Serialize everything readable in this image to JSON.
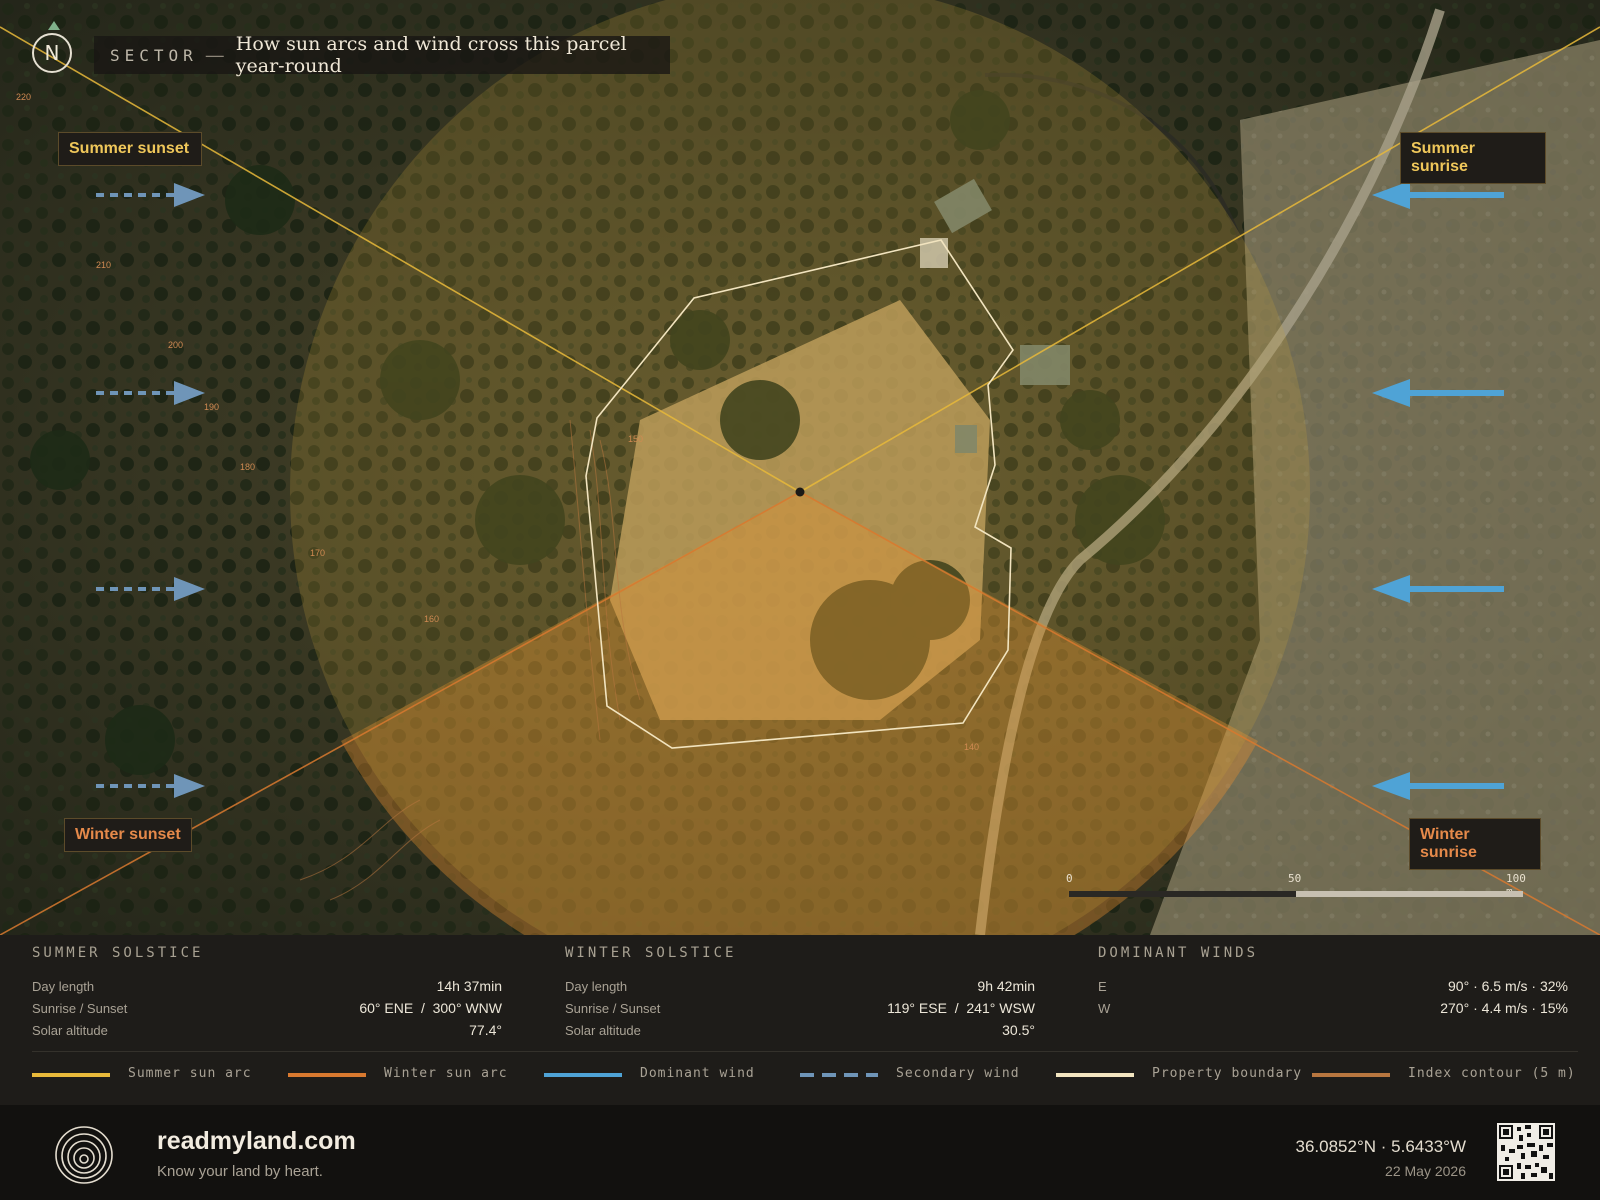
{
  "header": {
    "tag": "SECTOR",
    "dash": "—",
    "title": "How sun arcs and wind cross this parcel year-round",
    "north": "N"
  },
  "sun_labels": {
    "summer_sunset": "Summer sunset",
    "summer_sunrise": "Summer sunrise",
    "winter_sunset": "Winter sunset",
    "winter_sunrise": "Winter sunrise"
  },
  "contours": [
    "220",
    "210",
    "200",
    "190",
    "180",
    "170",
    "160",
    "150",
    "140"
  ],
  "scale": {
    "zero": "0",
    "mid": "50",
    "end": "100 m"
  },
  "summer": {
    "heading": "SUMMER SOLSTICE",
    "rows": [
      {
        "k": "Day length",
        "v": "14h 37min"
      },
      {
        "k": "Sunrise / Sunset",
        "v": "60° ENE  /  300° WNW"
      },
      {
        "k": "Solar altitude",
        "v": "77.4°"
      }
    ]
  },
  "winter": {
    "heading": "WINTER SOLSTICE",
    "rows": [
      {
        "k": "Day length",
        "v": "9h 42min"
      },
      {
        "k": "Sunrise / Sunset",
        "v": "119° ESE  /  241° WSW"
      },
      {
        "k": "Solar altitude",
        "v": "30.5°"
      }
    ]
  },
  "winds": {
    "heading": "DOMINANT WINDS",
    "rows": [
      {
        "k": "E",
        "v": "90° · 6.5 m/s · 32%"
      },
      {
        "k": "W",
        "v": "270° · 4.4 m/s · 15%"
      }
    ]
  },
  "legend": {
    "summer_arc": "Summer sun arc",
    "winter_arc": "Winter sun arc",
    "dominant_wind": "Dominant wind",
    "secondary_wind": "Secondary wind",
    "boundary": "Property boundary",
    "contour": "Index contour (5 m)"
  },
  "footer": {
    "brand": "readmyland.com",
    "tagline": "Know your land by heart.",
    "coords": "36.0852°N · 5.6433°W",
    "date": "22 May 2026"
  },
  "colors": {
    "summer": "#e8b93a",
    "winter": "#d9792f",
    "wind": "#4fa3d6",
    "secondary_wind": "#6f95b8",
    "boundary": "#f2e4bf",
    "contour": "#b8763f"
  }
}
